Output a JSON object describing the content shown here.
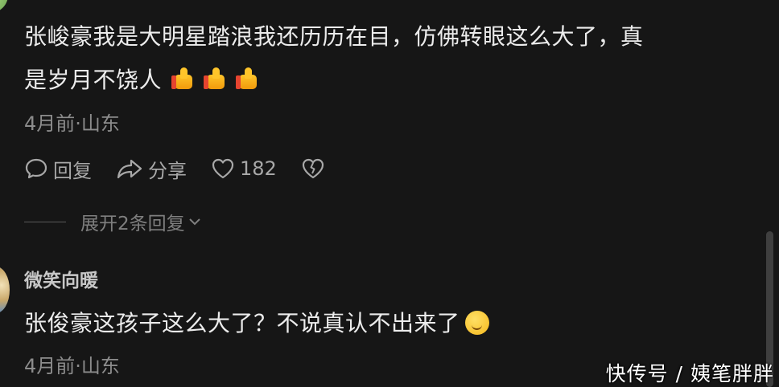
{
  "comment1": {
    "username": "",
    "text_line1": "张峻豪我是大明星踏浪我还历历在目，仿佛转眼这么大了，真",
    "text_line2": "是岁月不饶人",
    "emojis": [
      "thumbs-up",
      "thumbs-up",
      "thumbs-up"
    ],
    "meta": "4月前·山东",
    "actions": {
      "reply_label": "回复",
      "share_label": "分享",
      "like_count": "182"
    },
    "expand_label": "展开2条回复"
  },
  "comment2": {
    "username": "微笑向暖",
    "text": "张俊豪这孩子这么大了？不说真认不出来了",
    "emoji": "smirk-face",
    "meta": "4月前·山东"
  },
  "watermark": "快传号 / 姨笔胖胖",
  "colors": {
    "background": "#161616",
    "primary_text": "#ececec",
    "secondary_text": "#8c8c8c"
  }
}
